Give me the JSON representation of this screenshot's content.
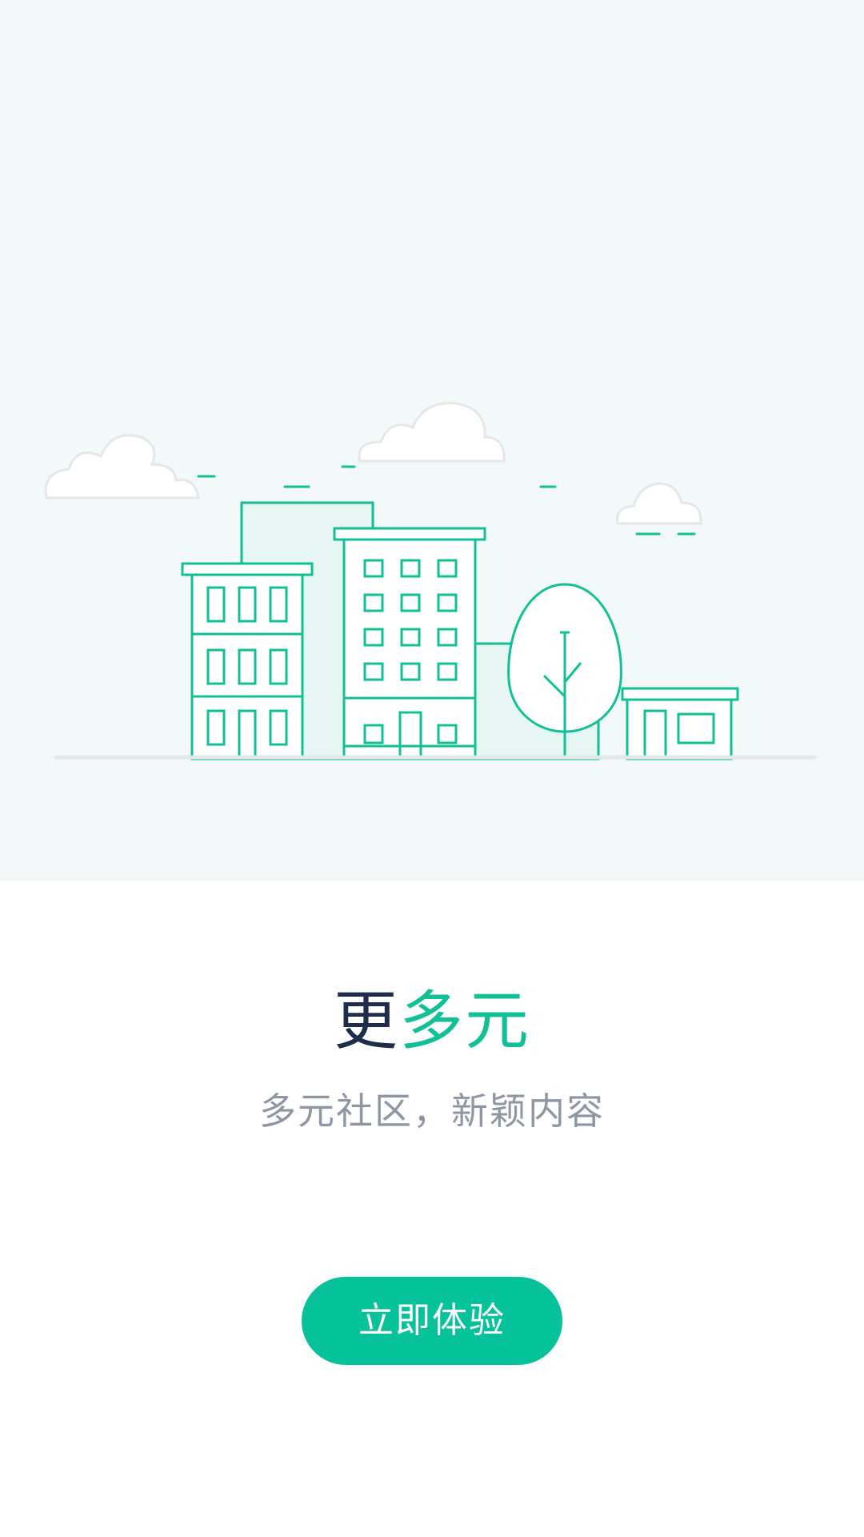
{
  "onboarding": {
    "title_dark": "更",
    "title_accent": "多元",
    "subtitle": "多元社区，新颖内容",
    "cta_label": "立即体验"
  },
  "colors": {
    "accent": "#05c29a",
    "title_dark": "#1f2d4a",
    "subtitle": "#8f96a3",
    "hero_background": "#f3f8f8"
  },
  "illustration": {
    "icons": [
      "cloud-icon",
      "building-icon",
      "tree-icon",
      "house-icon"
    ]
  }
}
